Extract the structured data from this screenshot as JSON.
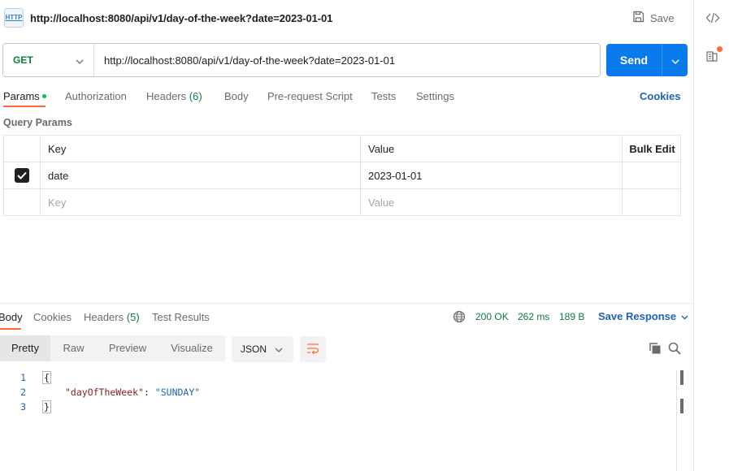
{
  "request": {
    "title": "http://localhost:8080/api/v1/day-of-the-week?date=2023-01-01",
    "icon_text": "HTTP",
    "save_label": "Save",
    "method": "GET",
    "url": "http://localhost:8080/api/v1/day-of-the-week?date=2023-01-01",
    "send_label": "Send"
  },
  "request_tabs": {
    "params": "Params",
    "authorization": "Authorization",
    "headers": "Headers",
    "headers_count": "(6)",
    "body": "Body",
    "pre_request": "Pre-request Script",
    "tests": "Tests",
    "settings": "Settings",
    "cookies": "Cookies"
  },
  "query_params": {
    "section_label": "Query Params",
    "columns": [
      "Key",
      "Value",
      "Bulk Edit"
    ],
    "rows": [
      {
        "checked": true,
        "key": "date",
        "value": "2023-01-01"
      }
    ],
    "placeholder_key": "Key",
    "placeholder_value": "Value"
  },
  "response_tabs": {
    "body": "Body",
    "cookies": "Cookies",
    "headers": "Headers",
    "headers_count": "(5)",
    "test_results": "Test Results"
  },
  "response_status": {
    "status": "200 OK",
    "time": "262 ms",
    "size": "189 B",
    "save_response": "Save Response"
  },
  "view_modes": [
    "Pretty",
    "Raw",
    "Preview",
    "Visualize"
  ],
  "format": "JSON",
  "response_body": {
    "line_numbers": [
      "1",
      "2",
      "3"
    ],
    "open_brace": "{",
    "key": "\"dayOfTheWeek\"",
    "colon": ": ",
    "value": "\"SUNDAY\"",
    "close_brace": "}"
  },
  "colors": {
    "accent": "#ff6c37",
    "send_button": "#097bed",
    "link": "#1f64b0",
    "status_green": "#0b7d3e"
  },
  "icons": [
    "http-request-icon",
    "save-icon",
    "chevron-down-icon",
    "globe-icon",
    "wrap-lines-icon",
    "copy-icon",
    "search-icon",
    "code-icon",
    "documentation-icon"
  ]
}
